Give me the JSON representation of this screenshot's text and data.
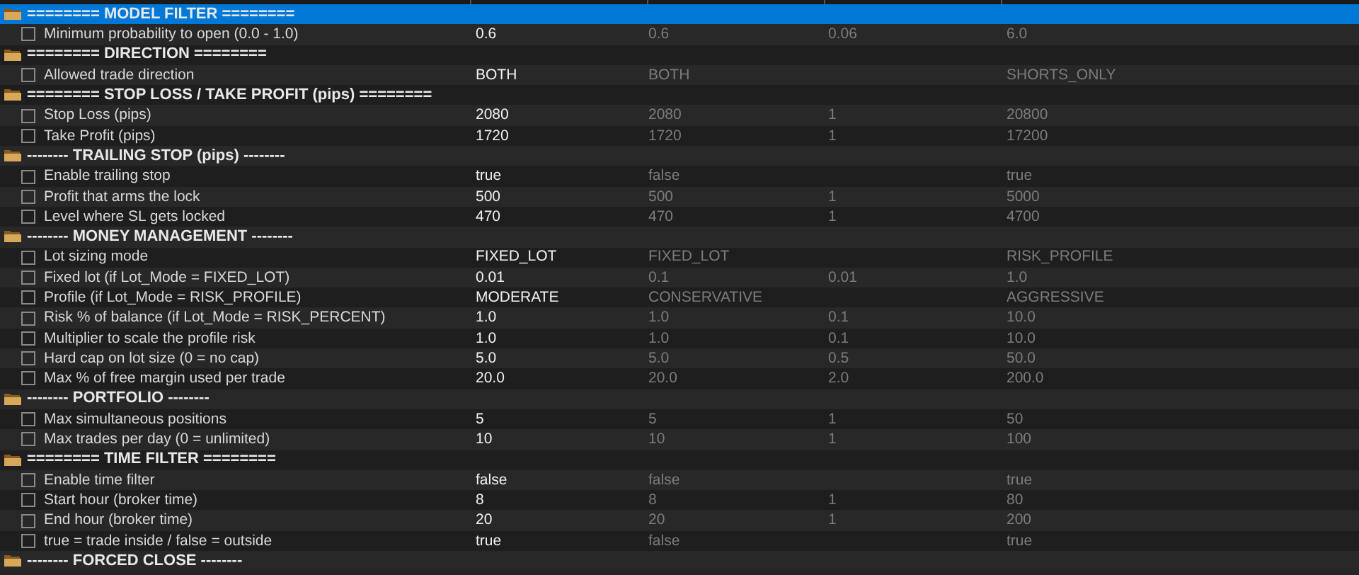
{
  "sections": [
    {
      "title": "======== MODEL FILTER ========",
      "selected": true,
      "params": [
        {
          "name": "Minimum probability to open (0.0 - 1.0)",
          "checked": false,
          "value": "0.6",
          "start": "0.6",
          "step": "0.06",
          "stop": "6.0"
        }
      ]
    },
    {
      "title": "======== DIRECTION ========",
      "selected": false,
      "params": [
        {
          "name": "Allowed trade direction",
          "checked": false,
          "value": "BOTH",
          "start": "BOTH",
          "stop": "SHORTS_ONLY"
        }
      ]
    },
    {
      "title": "======== STOP LOSS / TAKE PROFIT (pips) ========",
      "selected": false,
      "params": [
        {
          "name": "Stop Loss (pips)",
          "checked": false,
          "value": "2080",
          "start": "2080",
          "step": "1",
          "stop": "20800"
        },
        {
          "name": "Take Profit (pips)",
          "checked": false,
          "value": "1720",
          "start": "1720",
          "step": "1",
          "stop": "17200"
        }
      ]
    },
    {
      "title": "-------- TRAILING STOP (pips) --------",
      "selected": false,
      "params": [
        {
          "name": "Enable trailing stop",
          "checked": false,
          "value": "true",
          "start": "false",
          "stop": "true"
        },
        {
          "name": "Profit that arms the lock",
          "checked": false,
          "value": "500",
          "start": "500",
          "step": "1",
          "stop": "5000"
        },
        {
          "name": "Level where SL gets locked",
          "checked": false,
          "value": "470",
          "start": "470",
          "step": "1",
          "stop": "4700"
        }
      ]
    },
    {
      "title": "-------- MONEY MANAGEMENT --------",
      "selected": false,
      "params": [
        {
          "name": "Lot sizing mode",
          "checked": false,
          "value": "FIXED_LOT",
          "start": "FIXED_LOT",
          "stop": "RISK_PROFILE"
        },
        {
          "name": "Fixed lot (if Lot_Mode = FIXED_LOT)",
          "checked": false,
          "value": "0.01",
          "start": "0.1",
          "step": "0.01",
          "stop": "1.0"
        },
        {
          "name": "Profile (if Lot_Mode = RISK_PROFILE)",
          "checked": false,
          "value": "MODERATE",
          "start": "CONSERVATIVE",
          "stop": "AGGRESSIVE"
        },
        {
          "name": "Risk % of balance (if Lot_Mode = RISK_PERCENT)",
          "checked": false,
          "value": "1.0",
          "start": "1.0",
          "step": "0.1",
          "stop": "10.0"
        },
        {
          "name": "Multiplier to scale the profile risk",
          "checked": false,
          "value": "1.0",
          "start": "1.0",
          "step": "0.1",
          "stop": "10.0"
        },
        {
          "name": "Hard cap on lot size (0 = no cap)",
          "checked": false,
          "value": "5.0",
          "start": "5.0",
          "step": "0.5",
          "stop": "50.0"
        },
        {
          "name": "Max % of free margin used per trade",
          "checked": false,
          "value": "20.0",
          "start": "20.0",
          "step": "2.0",
          "stop": "200.0"
        }
      ]
    },
    {
      "title": "-------- PORTFOLIO --------",
      "selected": false,
      "params": [
        {
          "name": "Max simultaneous positions",
          "checked": false,
          "value": "5",
          "start": "5",
          "step": "1",
          "stop": "50"
        },
        {
          "name": "Max trades per day (0 = unlimited)",
          "checked": false,
          "value": "10",
          "start": "10",
          "step": "1",
          "stop": "100"
        }
      ]
    },
    {
      "title": "======== TIME FILTER ========",
      "selected": false,
      "params": [
        {
          "name": "Enable time filter",
          "checked": false,
          "value": "false",
          "start": "false",
          "stop": "true"
        },
        {
          "name": "Start hour (broker time)",
          "checked": false,
          "value": "8",
          "start": "8",
          "step": "1",
          "stop": "80"
        },
        {
          "name": "End hour (broker time)",
          "checked": false,
          "value": "20",
          "start": "20",
          "step": "1",
          "stop": "200"
        },
        {
          "name": "true = trade inside / false = outside",
          "checked": false,
          "value": "true",
          "start": "false",
          "stop": "true"
        }
      ]
    },
    {
      "title": "-------- FORCED CLOSE --------",
      "selected": false
    }
  ]
}
